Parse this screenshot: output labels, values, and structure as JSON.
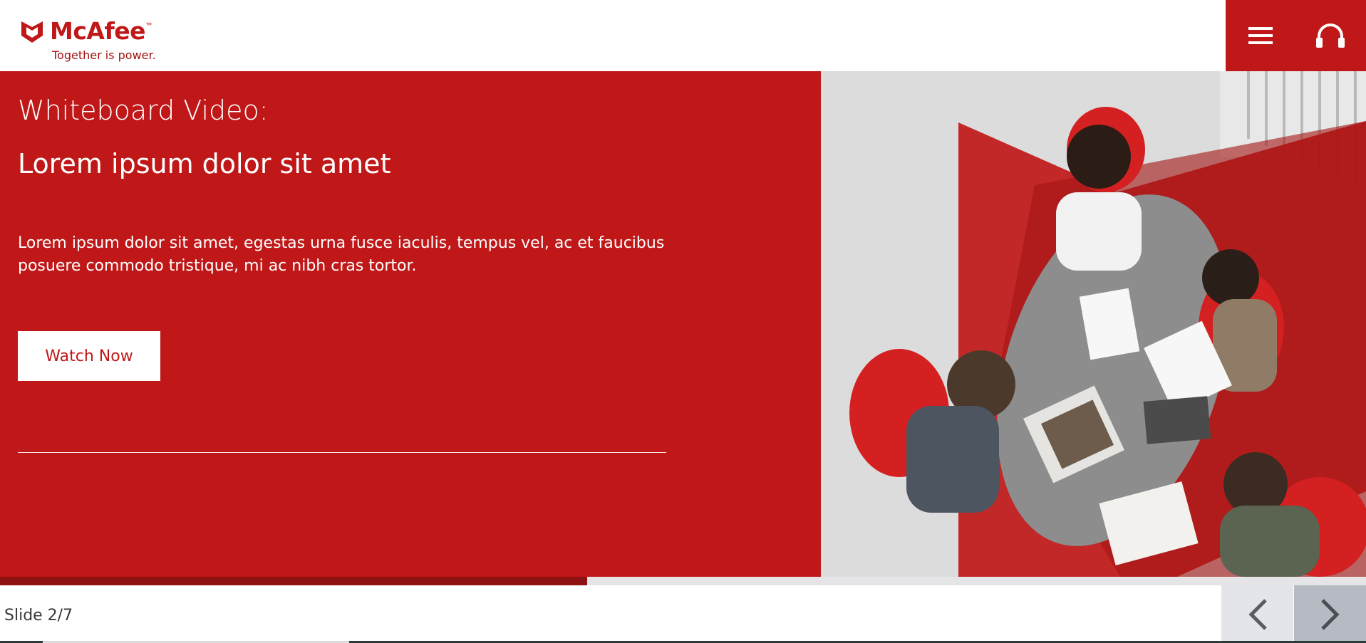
{
  "header": {
    "logo_text": "McAfee",
    "logo_tm": "™",
    "tagline": "Together is power.",
    "menu_icon": "hamburger-menu-icon",
    "support_icon": "headset-icon"
  },
  "hero": {
    "kicker": "Whiteboard Video:",
    "title": "Lorem ipsum dolor sit amet",
    "body": "Lorem ipsum dolor sit amet, egestas urna fusce iaculis, tempus vel, ac et faucibus posuere commodo tristique, mi ac nibh cras tortor.",
    "cta_label": "Watch Now",
    "image_description_icon": "team-meeting-photo"
  },
  "progress": {
    "fraction": 0.43
  },
  "footer": {
    "slide_label": "Slide 2/7",
    "prev_icon": "chevron-left-icon",
    "next_icon": "chevron-right-icon"
  },
  "colors": {
    "brand_red": "#c01818",
    "dark_red": "#8f1212",
    "white": "#ffffff"
  }
}
